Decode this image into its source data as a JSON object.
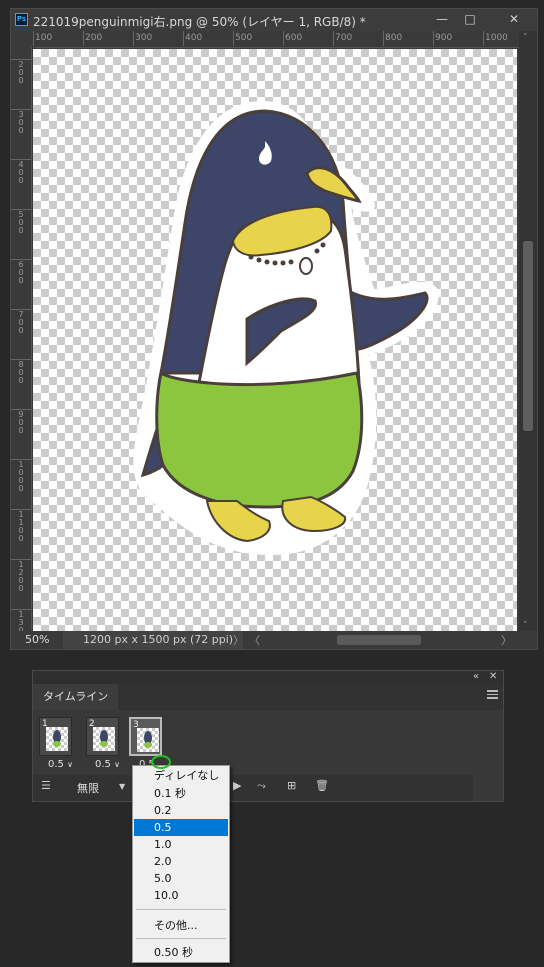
{
  "document": {
    "title": "221019penguinmigi右.png @ 50% (レイヤー 1, RGB/8) *",
    "app_badge": "Ps",
    "window_controls": {
      "minimize": "—",
      "maximize": "□",
      "close": "✕"
    },
    "ruler_h": [
      "100",
      "200",
      "300",
      "400",
      "500",
      "600",
      "700",
      "800",
      "900",
      "1000"
    ],
    "ruler_v": [
      "200",
      "300",
      "400",
      "500",
      "600",
      "700",
      "800",
      "900",
      "1000",
      "1100",
      "1200",
      "1300"
    ],
    "zoom": "50%",
    "doc_info": "1200 px x 1500 px (72 ppi)",
    "arrow_right": "〉",
    "arrow_left": "〈"
  },
  "timeline": {
    "tab_label": "タイムライン",
    "frames": [
      {
        "number": "1",
        "delay": "0.5"
      },
      {
        "number": "2",
        "delay": "0.5"
      },
      {
        "number": "3",
        "delay": "0.5"
      }
    ],
    "delay_caret": "∨",
    "loop_label": "無限",
    "collapse_icon": "«",
    "close_icon": "✕"
  },
  "delay_menu": {
    "items": [
      "ディレイなし",
      "0.1 秒",
      "0.2",
      "0.5",
      "1.0",
      "2.0",
      "5.0",
      "10.0"
    ],
    "selected_index": 3,
    "other": "その他...",
    "current": "0.50 秒"
  },
  "colors": {
    "penguin_body": "#3d4668",
    "belly": "#ffffff",
    "shorts": "#8cc63f",
    "beak_feet": "#e8d44a",
    "outline": "#4a3f3a",
    "selection_blue": "#0078d7",
    "annotation_circle": "#22c022"
  }
}
